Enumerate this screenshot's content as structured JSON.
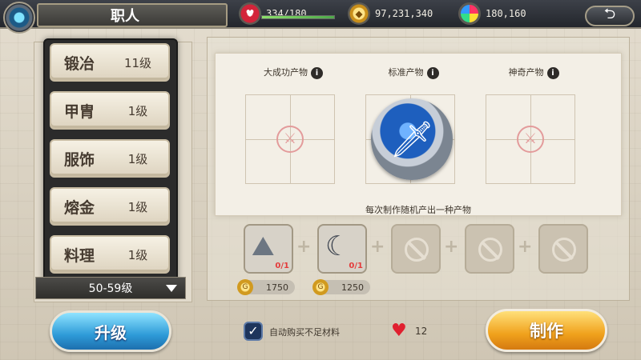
{
  "header": {
    "title": "职人",
    "stamina": "334/180",
    "stamina_fill": 1.0,
    "gold": "97,231,340",
    "gems": "180,160"
  },
  "jobs": [
    {
      "name": "锻冶",
      "level": "11级"
    },
    {
      "name": "甲胄",
      "level": "1级"
    },
    {
      "name": "服饰",
      "level": "1级"
    },
    {
      "name": "熔金",
      "level": "1级"
    },
    {
      "name": "料理",
      "level": "1级"
    }
  ],
  "level_range": "50-59级",
  "upgrade_label": "升级",
  "products": [
    {
      "label": "大成功产物",
      "state": "empty"
    },
    {
      "label": "标准产物",
      "state": "sword"
    },
    {
      "label": "神奇产物",
      "state": "empty"
    }
  ],
  "info_glyph": "i",
  "random_note": "每次制作随机产出一种产物",
  "materials": [
    {
      "icon": "stone-material-icon",
      "count": "0/1",
      "cost": "1750"
    },
    {
      "icon": "claw-material-icon",
      "count": "0/1",
      "cost": "1250"
    },
    {
      "icon": "blocked-slot-icon"
    },
    {
      "icon": "blocked-slot-icon"
    },
    {
      "icon": "blocked-slot-icon"
    }
  ],
  "auto_buy_label": "自动购买不足材料",
  "heart_count": "12",
  "craft_label": "制作",
  "colors": {
    "upgrade_button": "#2e9bd8",
    "craft_button": "#f0a11c",
    "material_count": "#e43b3b"
  }
}
